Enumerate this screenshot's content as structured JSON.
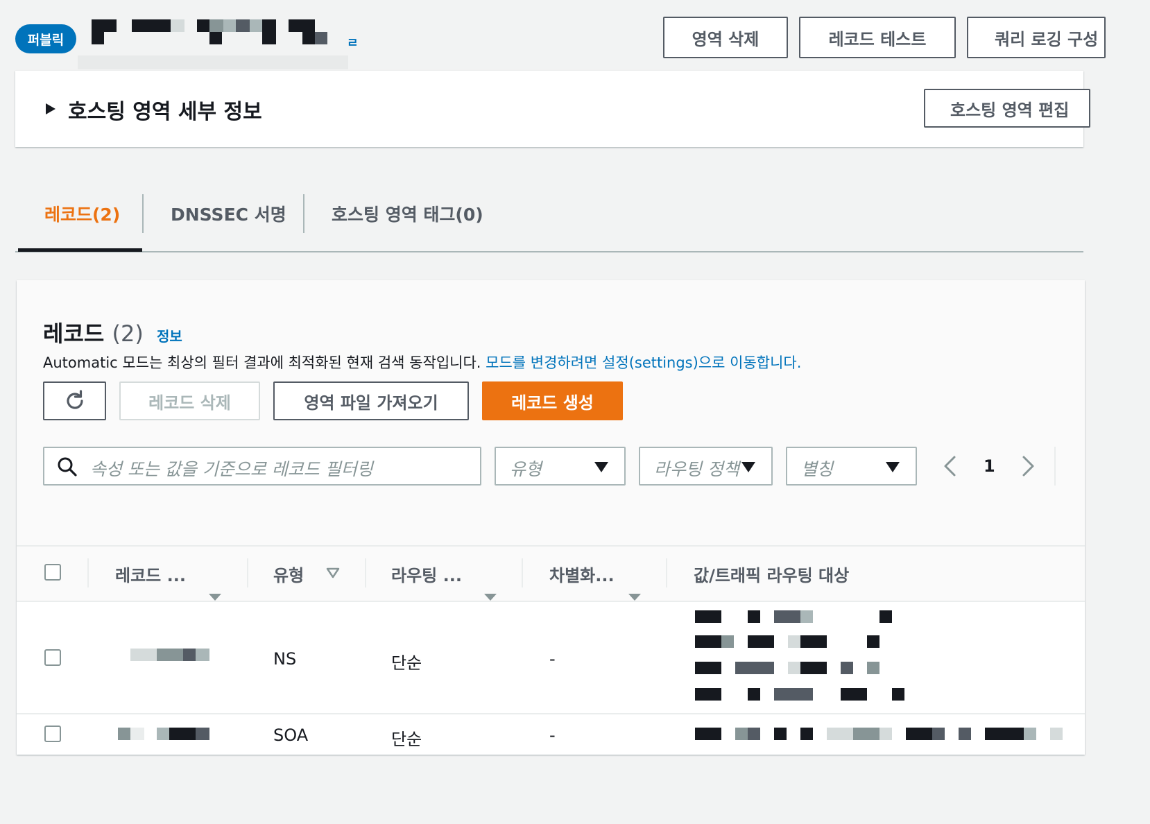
{
  "header": {
    "badge": "퍼블릭",
    "title_tail": "ㄹ",
    "buttons": {
      "delete_zone": "영역 삭제",
      "test_record": "레코드 테스트",
      "query_logging": "쿼리 로깅 구성"
    }
  },
  "details": {
    "title": "호스팅 영역 세부 정보",
    "edit_button": "호스팅 영역 편집"
  },
  "tabs": [
    {
      "label": "레코드(2)",
      "active": true
    },
    {
      "label": "DNSSEC 서명",
      "active": false
    },
    {
      "label": "호스팅 영역 태그(0)",
      "active": false
    }
  ],
  "records": {
    "title": "레코드",
    "count": "(2)",
    "info_link": "정보",
    "description": "Automatic 모드는 최상의 필터 결과에 최적화된 현재 검색 동작입니다.",
    "settings_link": "모드를 변경하려면 설정(settings)으로 이동합니다.",
    "actions": {
      "delete": "레코드 삭제",
      "import": "영역 파일 가져오기",
      "create": "레코드 생성"
    },
    "filter": {
      "search_placeholder": "속성 또는 값을 기준으로 레코드 필터링",
      "type_placeholder": "유형",
      "routing_placeholder": "라우팅 정책",
      "alias_placeholder": "별칭"
    },
    "pagination": {
      "page": "1"
    },
    "columns": [
      "레코드 ...",
      "유형",
      "라우팅 ...",
      "차별화...",
      "값/트래픽 라우팅 대상"
    ],
    "rows": [
      {
        "type": "NS",
        "routing": "단순",
        "differentiator": "-"
      },
      {
        "type": "SOA",
        "routing": "단순",
        "differentiator": "-"
      }
    ]
  },
  "colors": {
    "accent_orange": "#ec7211",
    "link_blue": "#0073bb",
    "border_dark": "#545b64"
  },
  "icons": [
    "refresh-icon",
    "search-icon",
    "chevron-left-icon",
    "chevron-right-icon",
    "caret-down-icon",
    "sort-icon"
  ]
}
